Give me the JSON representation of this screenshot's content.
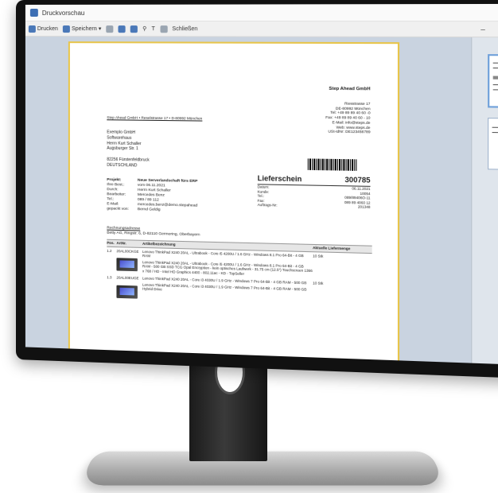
{
  "window": {
    "title": "Druckvorschau",
    "controls": [
      "–",
      "□",
      "✕"
    ]
  },
  "toolbar": {
    "print_label": "Drucken",
    "save_label": "Speichern",
    "close_label": "Schließen"
  },
  "document": {
    "sender_line": "Step Ahead GmbH • Reselstrasse 17 • D-80992 München",
    "company": "Step Ahead GmbH",
    "company_address": [
      "Riesstrasse 17",
      "DE-80992 München",
      "Tel: +49 89 89 40 60 -0",
      "Fax: +49 89 89 40 60 - 10",
      "E-Mail: info@steps.de",
      "Web: www.steps.de",
      "USt-IdNr: DE123456789"
    ],
    "recipient": [
      "Exemplo GmbH",
      "Softwarehaus",
      "Herrn Kurt Schaller",
      "Augsburger Str. 1",
      "",
      "82256 Fürstenfeldbruck",
      "DEUTSCHLAND"
    ],
    "doc_type": "Lieferschein",
    "doc_number": "300785",
    "meta": [
      {
        "k": "Datum:",
        "v": "06.11.2021"
      },
      {
        "k": "Kunde:",
        "v": "10054"
      },
      {
        "k": "Tel.:",
        "v": "089/89406O-11"
      },
      {
        "k": "Fax:",
        "v": "089 89 4060 12"
      },
      {
        "k": "Auftrags-Nr:",
        "v": "201348"
      }
    ],
    "project": [
      {
        "k": "Projekt:",
        "v": "Neue Serverlandschaft fürs ERP",
        "bold": true
      },
      {
        "k": "Ihre Best.:",
        "v": "vom 06.11.2021"
      },
      {
        "k": "Durch:",
        "v": "Herrn Kurt Schaller"
      },
      {
        "k": "Bearbeiter:",
        "v": "Mercedes Benz"
      },
      {
        "k": "Tel.:",
        "v": "089 / 89 112"
      },
      {
        "k": "E-Mail:",
        "v": "mercedes.benz@demo.stepahead"
      },
      {
        "k": "gepackt von:",
        "v": "Bernd Geldig"
      }
    ],
    "billing_label": "Rechnungsadresse",
    "billing_address": "Betty AG, Ringstr. 6, D-82110 Germering, Oberbayern",
    "columns": [
      "Pos.",
      "ArtNr.",
      "Artikelbezeichnung",
      "Aktuelle Liefermenge"
    ],
    "items": [
      {
        "pos": "1.2",
        "art": "20AL00CKGE",
        "desc": "Lenovo ThinkPad X240 20AL - Ultrabook - Core i5 4200U / 1.6 GHz - Windows 8.1 Pro 64-Bit - 4 GB RAM",
        "desc2": "Lenovo ThinkPad X240 20AL - Ultrabook - Core i5 4200U / 1.6 GHz - Windows 8.1 Pro 64-Bit - 4 GB RAM - 500 GB SSD TCG Opal Encryption - kein optisches Laufwerk - 31.75 cm (12.5\") Touchscreen 1366 x 768 / HD - Intel HD Graphics 4400 - 802.11ac - KD - TopSeller",
        "qty": "10 Stk"
      },
      {
        "pos": "1.3",
        "art": "20AL00EUGE",
        "desc": "Lenovo ThinkPad X240 20AL - Core i3 4030U / 1.9 GHz - Windows 7 Pro 64-Bit - 4 GB RAM - 500 GB",
        "desc2": "Lenovo ThinkPad X240 20AL - Core i3 4030U / 1.9 GHz - Windows 7 Pro 64-Bit - 4 GB RAM - 500 GB Hybrid Drive",
        "qty": "10 Stk"
      }
    ]
  }
}
